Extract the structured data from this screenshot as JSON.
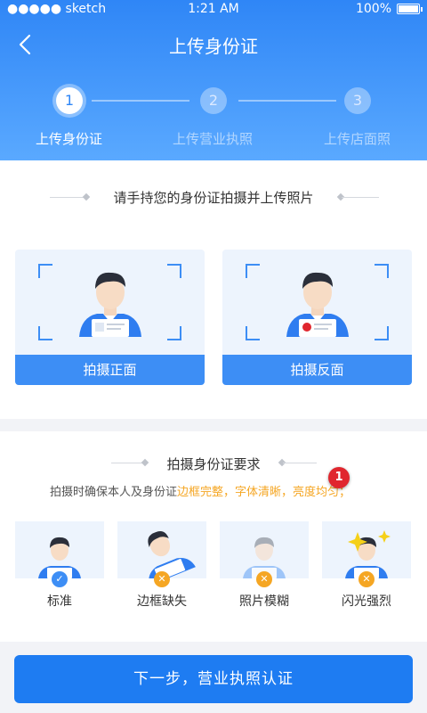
{
  "status_bar": {
    "carrier": "●●●●● sketch",
    "time": "1:21 AM",
    "battery": "100%"
  },
  "header": {
    "title": "上传身份证"
  },
  "steps": [
    {
      "number": "1",
      "label": "上传身份证",
      "active": true
    },
    {
      "number": "2",
      "label": "上传营业执照",
      "active": false
    },
    {
      "number": "3",
      "label": "上传店面照",
      "active": false
    }
  ],
  "upload": {
    "heading": "请手持您的身份证拍摄并上传照片",
    "front_button": "拍摄正面",
    "back_button": "拍摄反面"
  },
  "requirements": {
    "heading": "拍摄身份证要求",
    "desc_plain": "拍摄时确保本人及身份证",
    "desc_highlight": "边框完整，字体清晰，亮度均匀；",
    "badge_count": "1",
    "samples": [
      {
        "label": "标准",
        "status": "ok"
      },
      {
        "label": "边框缺失",
        "status": "bad"
      },
      {
        "label": "照片模糊",
        "status": "bad"
      },
      {
        "label": "闪光强烈",
        "status": "bad"
      }
    ]
  },
  "next_button": "下一步，营业执照认证",
  "colors": {
    "primary": "#1e7cf2",
    "warning": "#f5a623",
    "badge": "#e0262e"
  }
}
